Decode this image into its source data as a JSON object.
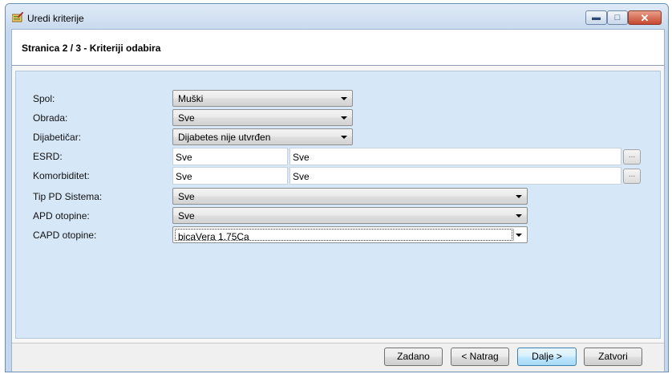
{
  "window": {
    "title": "Uredi kriterije",
    "icon": "edit-icon"
  },
  "caption_buttons": {
    "minimize": "▬",
    "maximize": "□",
    "close": "✕"
  },
  "page": {
    "title": "Stranica 2 / 3 - Kriteriji odabira"
  },
  "fields": {
    "spol": {
      "label": "Spol:",
      "value": "Muški"
    },
    "obrada": {
      "label": "Obrada:",
      "value": "Sve"
    },
    "dijabeticar": {
      "label": "Dijabetičar:",
      "value": "Dijabetes nije utvrđen"
    },
    "esrd": {
      "label": "ESRD:",
      "value1": "Sve",
      "value2": "Sve",
      "button": "..."
    },
    "komorbiditet": {
      "label": "Komorbiditet:",
      "value1": "Sve",
      "value2": "Sve",
      "button": "..."
    },
    "tip_pd": {
      "label": "Tip PD Sistema:",
      "value": "Sve"
    },
    "apd": {
      "label": "APD otopine:",
      "value": "Sve"
    },
    "capd": {
      "label": "CAPD otopine:",
      "value": "bicaVera 1.75Ca"
    }
  },
  "footer": {
    "zadano": "Zadano",
    "natrag": "< Natrag",
    "dalje": "Dalje >",
    "zatvori": "Zatvori"
  }
}
